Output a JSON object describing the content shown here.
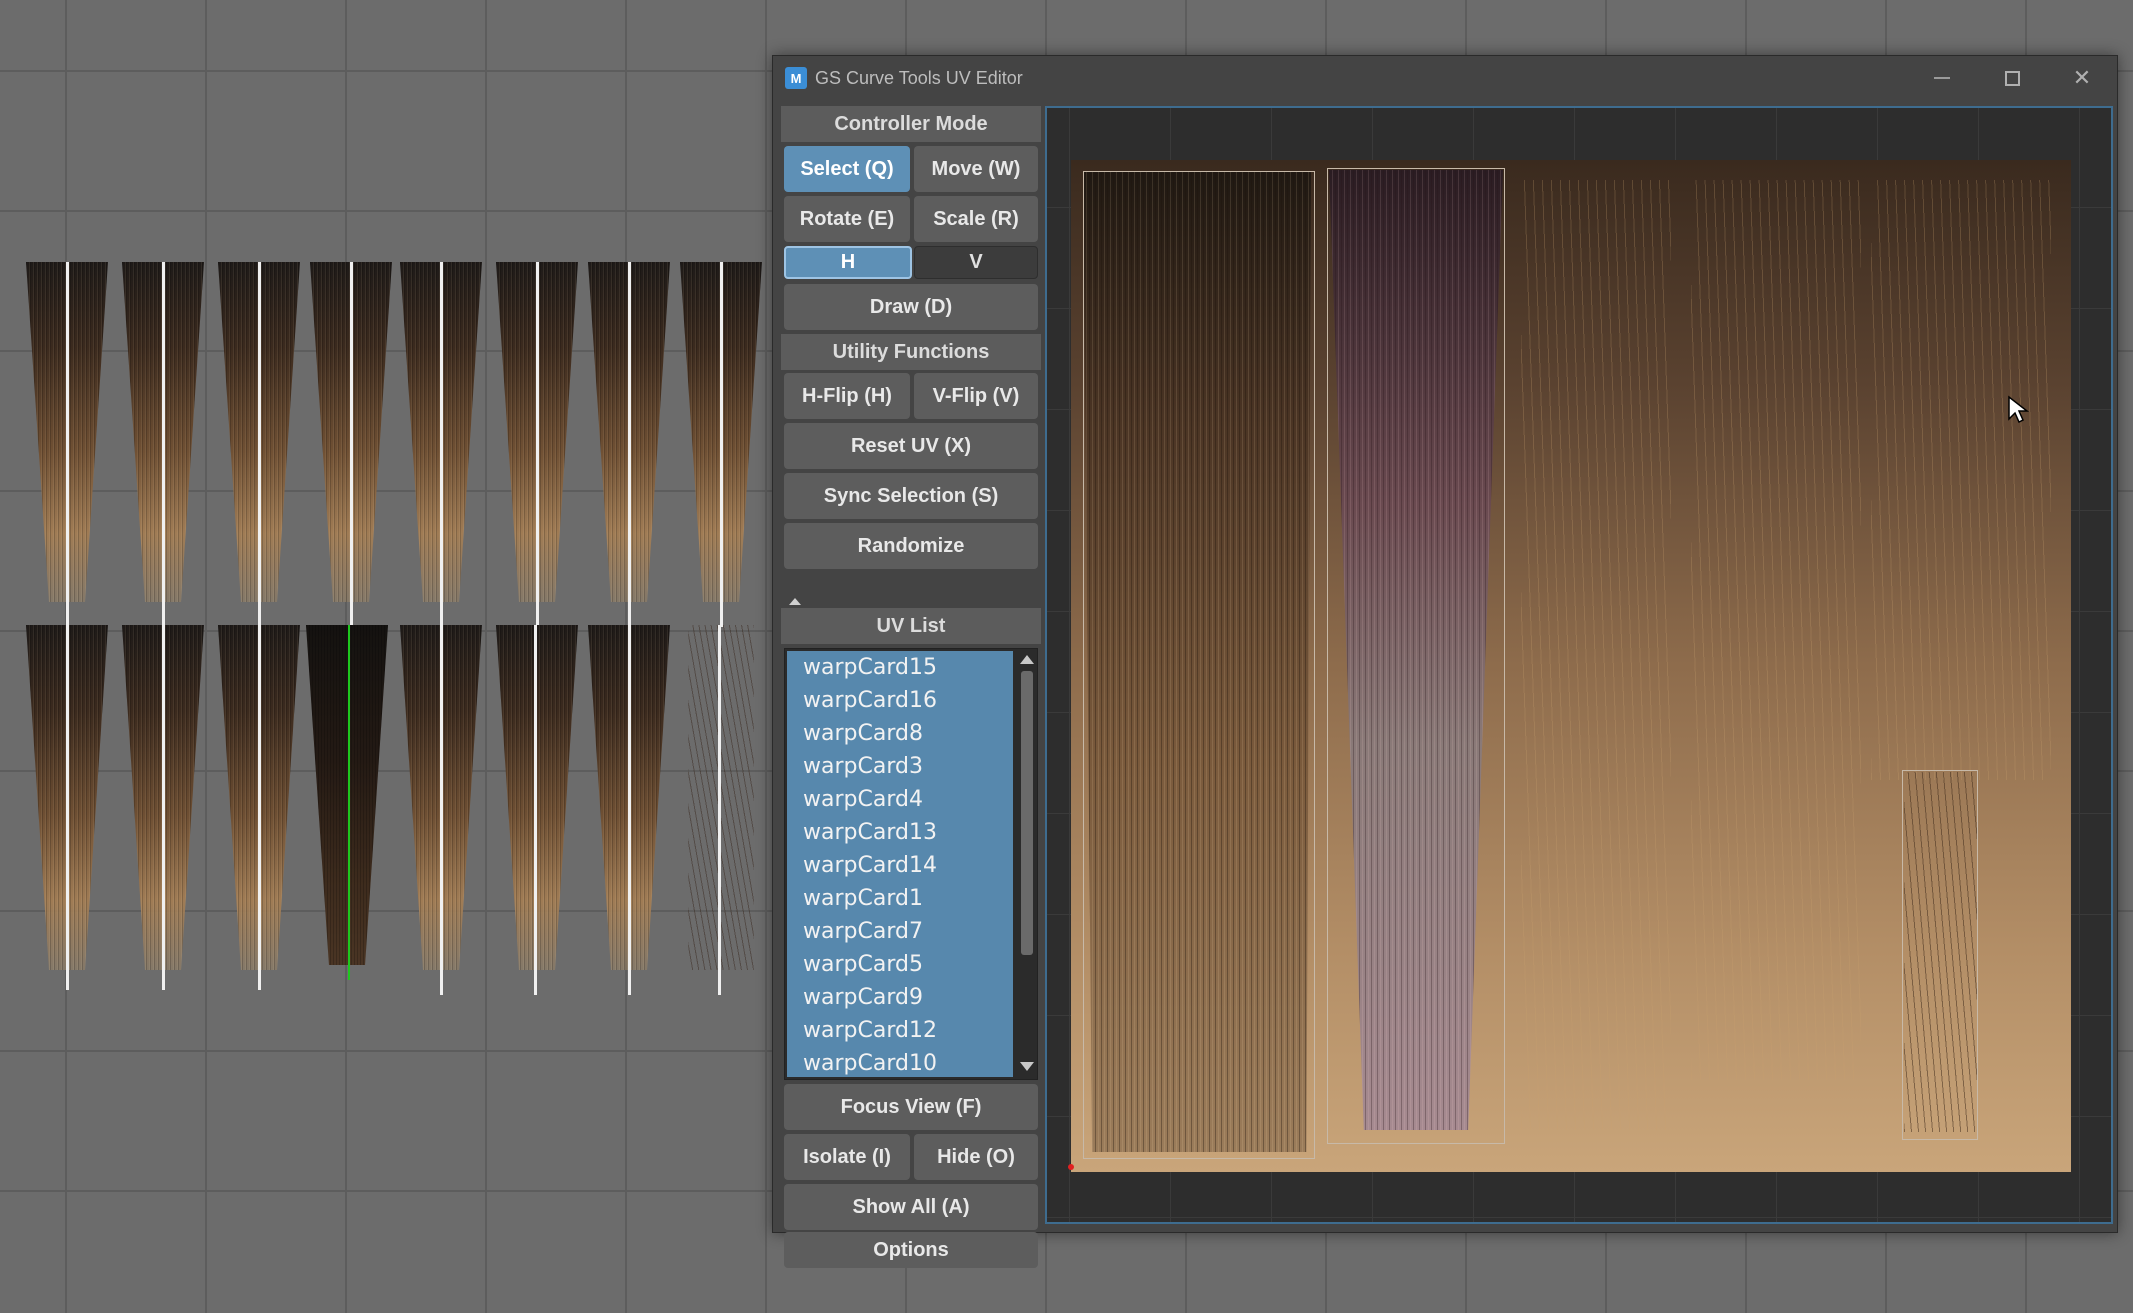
{
  "window": {
    "title": "GS Curve Tools UV Editor",
    "icon": "maya-app-icon",
    "controls": [
      "minimize-icon",
      "maximize-icon",
      "close-icon"
    ]
  },
  "controller_mode": {
    "header": "Controller Mode",
    "select": "Select (Q)",
    "move": "Move (W)",
    "rotate": "Rotate (E)",
    "scale": "Scale (R)",
    "h": "H",
    "v": "V",
    "draw": "Draw (D)"
  },
  "utility_functions": {
    "header": "Utility Functions",
    "hflip": "H-Flip (H)",
    "vflip": "V-Flip (V)",
    "reset_uv": "Reset UV (X)",
    "sync_selection": "Sync Selection (S)",
    "randomize": "Randomize"
  },
  "uv_list": {
    "header": "UV List",
    "items": [
      "warpCard15",
      "warpCard16",
      "warpCard8",
      "warpCard3",
      "warpCard4",
      "warpCard13",
      "warpCard14",
      "warpCard1",
      "warpCard7",
      "warpCard5",
      "warpCard9",
      "warpCard12",
      "warpCard10"
    ]
  },
  "view_controls": {
    "focus_view": "Focus View (F)",
    "isolate": "Isolate (I)",
    "hide": "Hide (O)",
    "show_all": "Show All (A)",
    "options": "Options"
  },
  "colors": {
    "accent": "#5e90b6",
    "panel_bg": "#444444",
    "button_bg": "#5d5d5d",
    "selection_list_bg": "#5788ad",
    "canvas_border": "#3e6c8f"
  }
}
